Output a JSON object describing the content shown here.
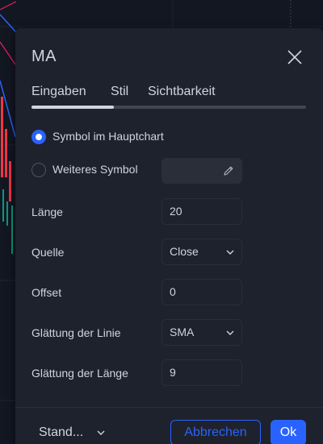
{
  "dialog": {
    "title": "MA",
    "tabs": [
      {
        "label": "Eingaben",
        "active": true
      },
      {
        "label": "Stil",
        "active": false
      },
      {
        "label": "Sichtbarkeit",
        "active": false
      }
    ]
  },
  "source": {
    "main_chart_label": "Symbol im Hauptchart",
    "main_chart_selected": true,
    "other_symbol_label": "Weiteres Symbol",
    "other_symbol_selected": false,
    "other_symbol_value": ""
  },
  "fields": {
    "length": {
      "label": "Länge",
      "value": "20"
    },
    "source": {
      "label": "Quelle",
      "value": "Close"
    },
    "offset": {
      "label": "Offset",
      "value": "0"
    },
    "smoothing_line": {
      "label": "Glättung der Linie",
      "value": "SMA"
    },
    "smoothing_length": {
      "label": "Glättung der Länge",
      "value": "9"
    }
  },
  "footer": {
    "preset_label": "Stand...",
    "cancel_label": "Abbrechen",
    "ok_label": "Ok"
  },
  "colors": {
    "accent": "#2962ff",
    "dialog_bg": "#1e222d",
    "chart_bg": "#131722",
    "text": "#d1d4dc"
  }
}
